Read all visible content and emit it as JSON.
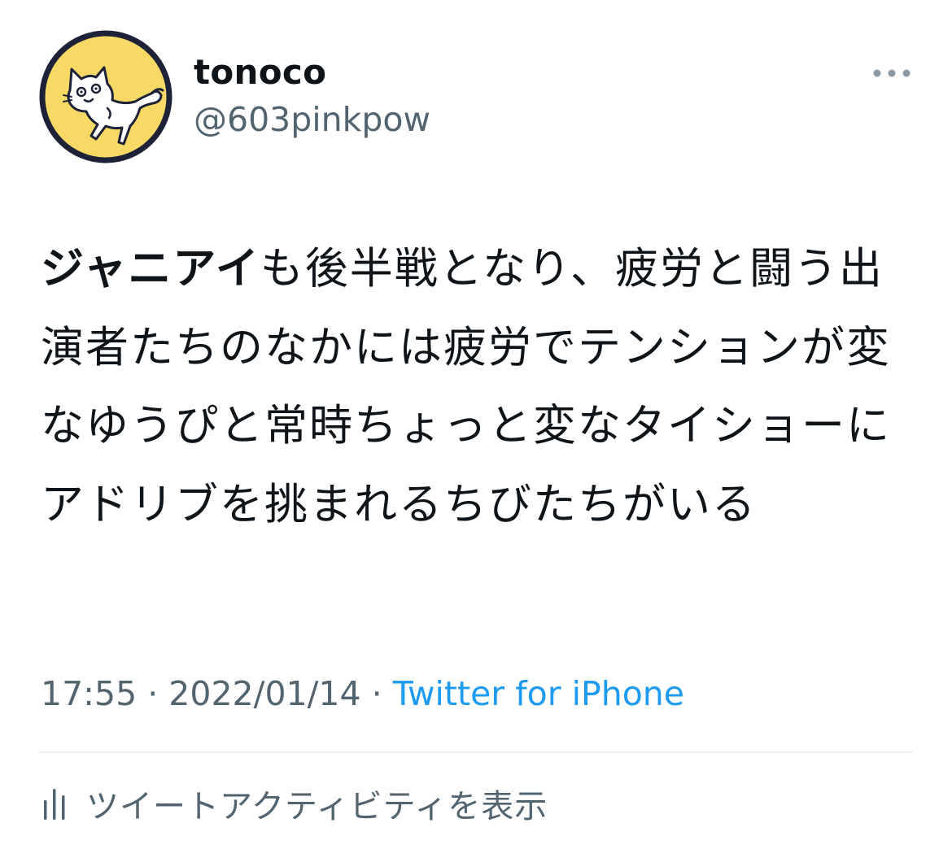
{
  "user": {
    "display_name": "tonoco",
    "handle": "@603pinkpow",
    "avatar_icon": "cat-avatar-icon",
    "avatar_bg": "#f8d965"
  },
  "more_icon": "more-horizontal-icon",
  "tweet": {
    "bold_text": "ジャニアイ",
    "text": "も後半戦となり、疲労と闘う出演者たちのなかには疲労でテンションが変なゆうぴと常時ちょっと変なタイショーにアドリブを挑まれるちびたちがいる",
    "time": "17:55",
    "separator": "·",
    "date": "2022/01/14",
    "source": "Twitter for iPhone"
  },
  "activity": {
    "icon": "analytics-bars-icon",
    "label": "ツイートアクティビティを表示"
  },
  "colors": {
    "text": "#0f1419",
    "secondary": "#536471",
    "link": "#1d9bf0"
  }
}
